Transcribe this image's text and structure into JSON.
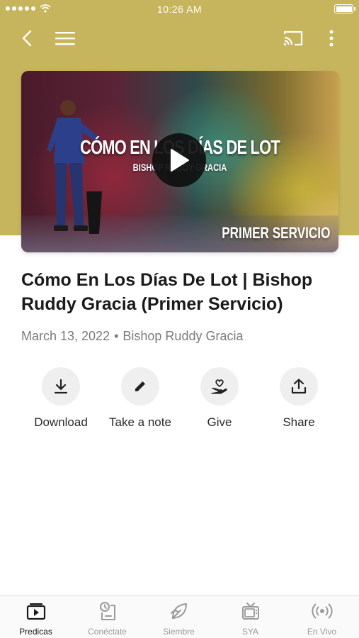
{
  "status_bar": {
    "time": "10:26 AM"
  },
  "nav": {
    "back_icon": "chevron-left-icon",
    "menu_icon": "hamburger-menu-icon",
    "cast_icon": "cast-icon",
    "more_icon": "more-vertical-icon"
  },
  "colors": {
    "hero_background": "#c6b55c",
    "action_circle": "#efefef",
    "tab_active": "#1a1a1a",
    "tab_inactive": "#9a9a9a"
  },
  "video": {
    "thumbnail_title": "CÓMO EN LOS DÍAS DE LOT",
    "thumbnail_subtitle": "BISHOP RUDDY GRACIA",
    "thumbnail_service": "PRIMER SERVICIO",
    "play_icon": "play-icon"
  },
  "sermon": {
    "title": "Cómo En Los Días De Lot | Bishop Ruddy Gracia (Primer Servicio)",
    "date": "March 13, 2022",
    "separator": "•",
    "speaker": "Bishop Ruddy Gracia"
  },
  "actions": [
    {
      "label": "Download",
      "icon": "download-icon"
    },
    {
      "label": "Take a note",
      "icon": "pencil-icon"
    },
    {
      "label": "Give",
      "icon": "give-heart-hand-icon"
    },
    {
      "label": "Share",
      "icon": "share-upload-icon"
    }
  ],
  "tabs": [
    {
      "label": "Predicas",
      "icon": "video-play-icon",
      "active": true
    },
    {
      "label": "Conéctate",
      "icon": "connect-icon",
      "active": false
    },
    {
      "label": "Siembre",
      "icon": "leaf-icon",
      "active": false
    },
    {
      "label": "SYA",
      "icon": "tv-icon",
      "active": false
    },
    {
      "label": "En Vivo",
      "icon": "broadcast-icon",
      "active": false
    }
  ]
}
